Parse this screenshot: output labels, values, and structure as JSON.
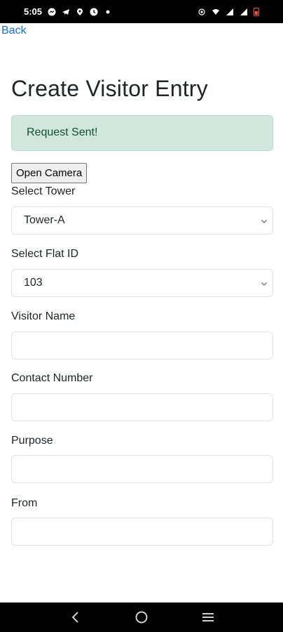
{
  "status_bar": {
    "time": "5:05"
  },
  "nav": {
    "back_label": "Back"
  },
  "page": {
    "title": "Create Visitor Entry",
    "alert_text": "Request Sent!",
    "camera_button_label": "Open Camera"
  },
  "form": {
    "tower": {
      "label": "Select Tower",
      "selected": "Tower-A"
    },
    "flat": {
      "label": "Select Flat ID",
      "selected": "103"
    },
    "visitor_name": {
      "label": "Visitor Name",
      "value": "",
      "placeholder": ""
    },
    "contact_number": {
      "label": "Contact Number",
      "value": "",
      "placeholder": ""
    },
    "purpose": {
      "label": "Purpose",
      "value": "",
      "placeholder": ""
    },
    "from": {
      "label": "From",
      "value": "",
      "placeholder": ""
    }
  },
  "colors": {
    "link": "#0d6efd",
    "alert_bg": "#d1e7dd",
    "alert_text": "#0f5132",
    "battery": "#ff4d3d"
  }
}
